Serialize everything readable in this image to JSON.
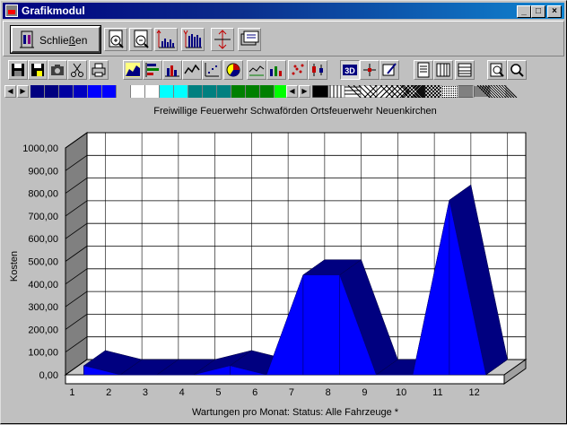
{
  "window": {
    "title": "Grafikmodul",
    "controls": {
      "minimize": "_",
      "maximize": "□",
      "close": "×"
    }
  },
  "toolbar": {
    "close_label_prefix": "Schlie",
    "close_label_underline": "ß",
    "close_label_suffix": "en",
    "icons": [
      "zoom-in-icon",
      "zoom-out-icon",
      "bar-chart-icon",
      "bar-chart-labels-icon",
      "vertical-resize-icon",
      "export-icon"
    ]
  },
  "toolbar2": {
    "icons": [
      "save-icon",
      "save-as-icon",
      "camera-icon",
      "cut-icon",
      "print-icon",
      "area-chart-icon",
      "horizontal-bar-icon",
      "column-chart-icon",
      "line-chart-icon",
      "scatter-chart-icon",
      "pie-chart-icon",
      "line-area-icon",
      "combo-chart-icon",
      "dots-chart-icon",
      "candlestick-icon",
      "3d-icon",
      "grid-tool-icon",
      "edit-tool-icon",
      "document-icon",
      "columns-view-icon",
      "rows-view-icon",
      "zoom-search-icon",
      "magnifier-icon"
    ],
    "pressed": "3d-icon",
    "label_3d": "3D"
  },
  "palette": {
    "colors": [
      "#000080",
      "#000080",
      "#0000a0",
      "#0000c0",
      "#0000ff",
      "#0000ff",
      "#c0c0c0",
      "#ffffff",
      "#ffffff",
      "#00ffff",
      "#00ffff",
      "#008080",
      "#008080",
      "#008080",
      "#008000",
      "#008000",
      "#008000",
      "#00ff00"
    ],
    "patterns": [
      "solid-black",
      "vertical-lines",
      "horizontal-lines",
      "diagonal-down",
      "diagonal-up",
      "cross-hatch",
      "diamond",
      "crosshatch-fine",
      "dense-dots",
      "vertical-fine",
      "horizontal-fine",
      "diagonal-fine"
    ]
  },
  "chart_data": {
    "type": "area",
    "title": "Freiwillige Feuerwehr Schwaförden Ortsfeuerwehr Neuenkirchen",
    "xlabel": "Wartungen pro Monat: Status: Alle Fahrzeuge *",
    "ylabel": "Kosten",
    "categories": [
      "1",
      "2",
      "3",
      "4",
      "5",
      "6",
      "7",
      "8",
      "9",
      "10",
      "11",
      "12"
    ],
    "values": [
      40,
      0,
      0,
      0,
      40,
      0,
      440,
      440,
      0,
      0,
      770,
      0
    ],
    "ylim": [
      0,
      1000
    ],
    "yticks": [
      "0,00",
      "100,00",
      "200,00",
      "300,00",
      "400,00",
      "500,00",
      "600,00",
      "700,00",
      "800,00",
      "900,00",
      "1000,00"
    ],
    "three_d": true,
    "grid": true,
    "colors": {
      "front": "#0000ff",
      "top": "#000080",
      "wall": "#808080",
      "floor": "#a0a0a0",
      "plot_bg": "#ffffff"
    }
  }
}
